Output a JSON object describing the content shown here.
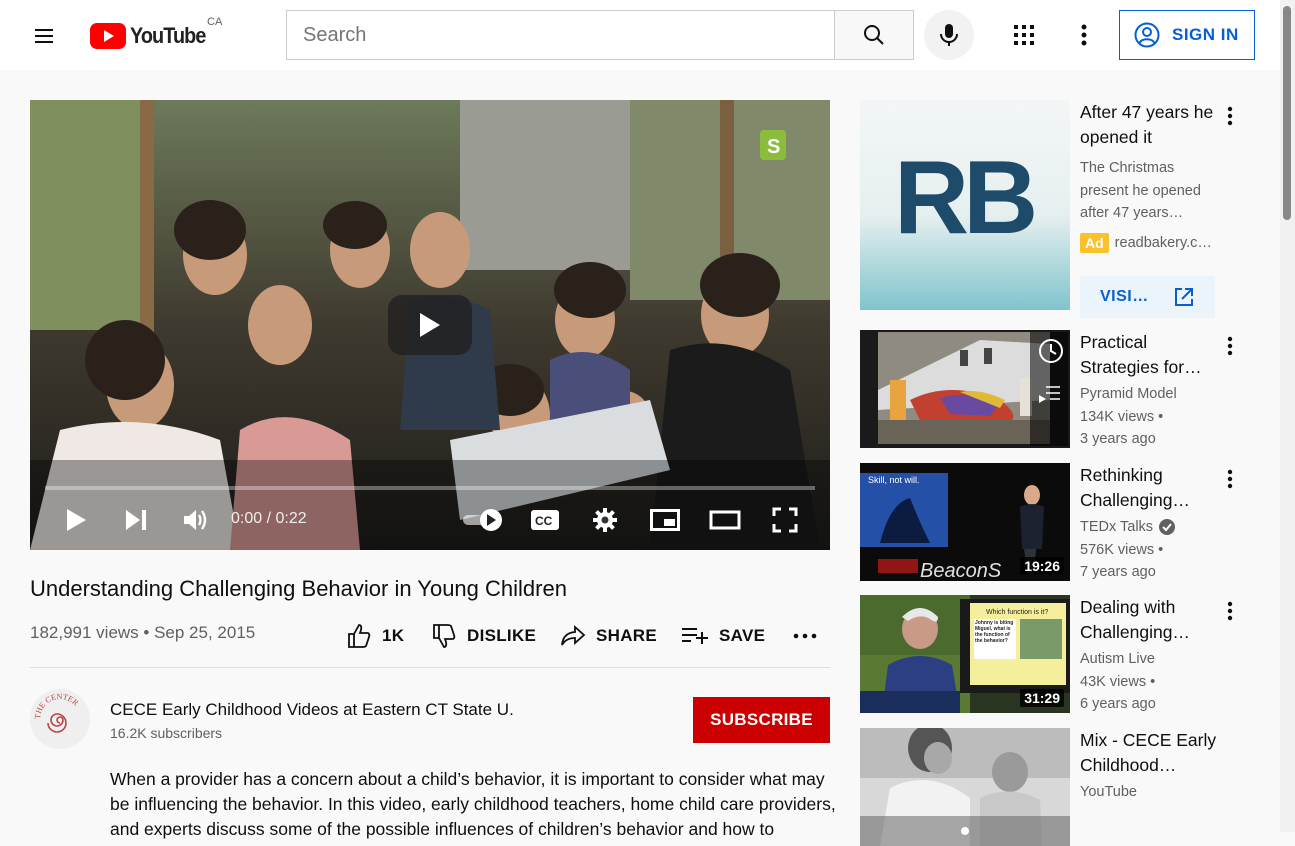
{
  "header": {
    "logo_text": "YouTube",
    "country": "CA",
    "search_placeholder": "Search",
    "signin_label": "SIGN IN",
    "brand_color": "#ff0000",
    "link_color": "#065fd4"
  },
  "player": {
    "time": "0:00 / 0:22",
    "icons": [
      "play-icon",
      "next-icon",
      "volume-icon",
      "autoplay-toggle",
      "captions-icon",
      "settings-icon",
      "miniplayer-icon",
      "theater-icon",
      "fullscreen-icon"
    ]
  },
  "video": {
    "title": "Understanding Challenging Behavior in Young Children",
    "views_date": "182,991 views • Sep 25, 2015",
    "like_count": "1K",
    "dislike_label": "DISLIKE",
    "share_label": "SHARE",
    "save_label": "SAVE"
  },
  "channel": {
    "name": "CECE Early Childhood Videos at Eastern CT State U.",
    "subscribers": "16.2K subscribers",
    "subscribe_label": "SUBSCRIBE",
    "avatar_text": "THE CENTER",
    "description": "When a provider has a concern about a child’s behavior, it is important to consider what may be influencing the behavior. In this video, early childhood teachers, home child care providers, and experts discuss some of the possible influences of children’s behavior and how to"
  },
  "sidebar": {
    "ad": {
      "title": "After 47 years he opened it",
      "description": "The Christmas present he opened after 47 years…",
      "badge": "Ad",
      "domain": "readbakery.c…",
      "thumb_text": "RB",
      "visit_label": "VISI…"
    },
    "videos": [
      {
        "title": "Practical Strategies for…",
        "channel": "Pyramid Model",
        "views": "134K views •",
        "age": "3 years ago",
        "duration": ""
      },
      {
        "title": "Rethinking Challenging…",
        "channel": "TEDx Talks",
        "views": "576K views •",
        "age": "7 years ago",
        "duration": "19:26",
        "thumb_caption": "Skill, not will.",
        "thumb_logo": "BeaconS"
      },
      {
        "title": "Dealing with Challenging…",
        "channel": "Autism Live",
        "views": "43K views •",
        "age": "6 years ago",
        "duration": "31:29",
        "thumb_slide_title": "Which function is it?",
        "thumb_slide_text": "Johnny is biting Miguel, what is the function of the behavior?"
      },
      {
        "title": "Mix - CECE Early Childhood…",
        "channel": "YouTube",
        "views": "",
        "age": "",
        "duration": ""
      }
    ]
  }
}
